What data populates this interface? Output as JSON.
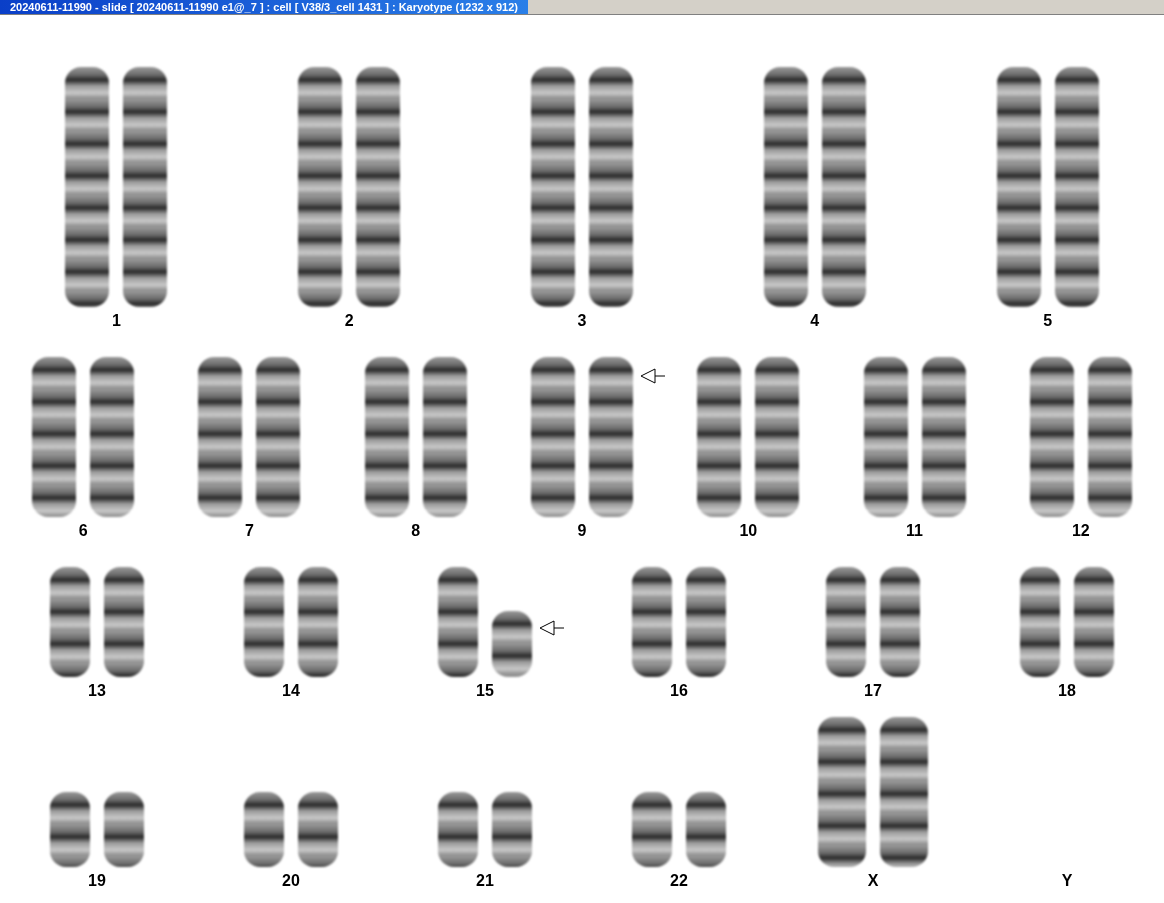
{
  "window": {
    "title": "20240611-11990 - slide [ 20240611-11990 e1@_7 ] : cell [ V38/3_cell 1431 ] : Karyotype  (1232 x 912)"
  },
  "rows": [
    {
      "groups": [
        {
          "label": "1",
          "kind": "pair",
          "marked": false
        },
        {
          "label": "2",
          "kind": "pair",
          "marked": false
        },
        {
          "label": "3",
          "kind": "pair",
          "marked": false
        },
        {
          "label": "4",
          "kind": "pair",
          "marked": false
        },
        {
          "label": "5",
          "kind": "pair",
          "marked": false
        }
      ]
    },
    {
      "groups": [
        {
          "label": "6",
          "kind": "pair",
          "marked": false
        },
        {
          "label": "7",
          "kind": "pair",
          "marked": false
        },
        {
          "label": "8",
          "kind": "pair",
          "marked": false
        },
        {
          "label": "9",
          "kind": "pair",
          "marked": true
        },
        {
          "label": "10",
          "kind": "pair",
          "marked": false
        },
        {
          "label": "11",
          "kind": "pair",
          "marked": false
        },
        {
          "label": "12",
          "kind": "pair",
          "marked": false
        }
      ]
    },
    {
      "groups": [
        {
          "label": "13",
          "kind": "pair",
          "marked": false
        },
        {
          "label": "14",
          "kind": "pair",
          "marked": false
        },
        {
          "label": "15",
          "kind": "pair",
          "marked": true
        },
        {
          "label": "16",
          "kind": "pair",
          "marked": false
        },
        {
          "label": "17",
          "kind": "pair",
          "marked": false
        },
        {
          "label": "18",
          "kind": "pair",
          "marked": false
        }
      ]
    },
    {
      "groups": [
        {
          "label": "19",
          "kind": "pair",
          "marked": false
        },
        {
          "label": "20",
          "kind": "pair",
          "marked": false
        },
        {
          "label": "21",
          "kind": "pair",
          "marked": false
        },
        {
          "label": "22",
          "kind": "pair",
          "marked": false
        },
        {
          "label": "X",
          "kind": "tall-pair",
          "marked": false
        },
        {
          "label": "Y",
          "kind": "empty",
          "marked": false
        }
      ]
    }
  ]
}
